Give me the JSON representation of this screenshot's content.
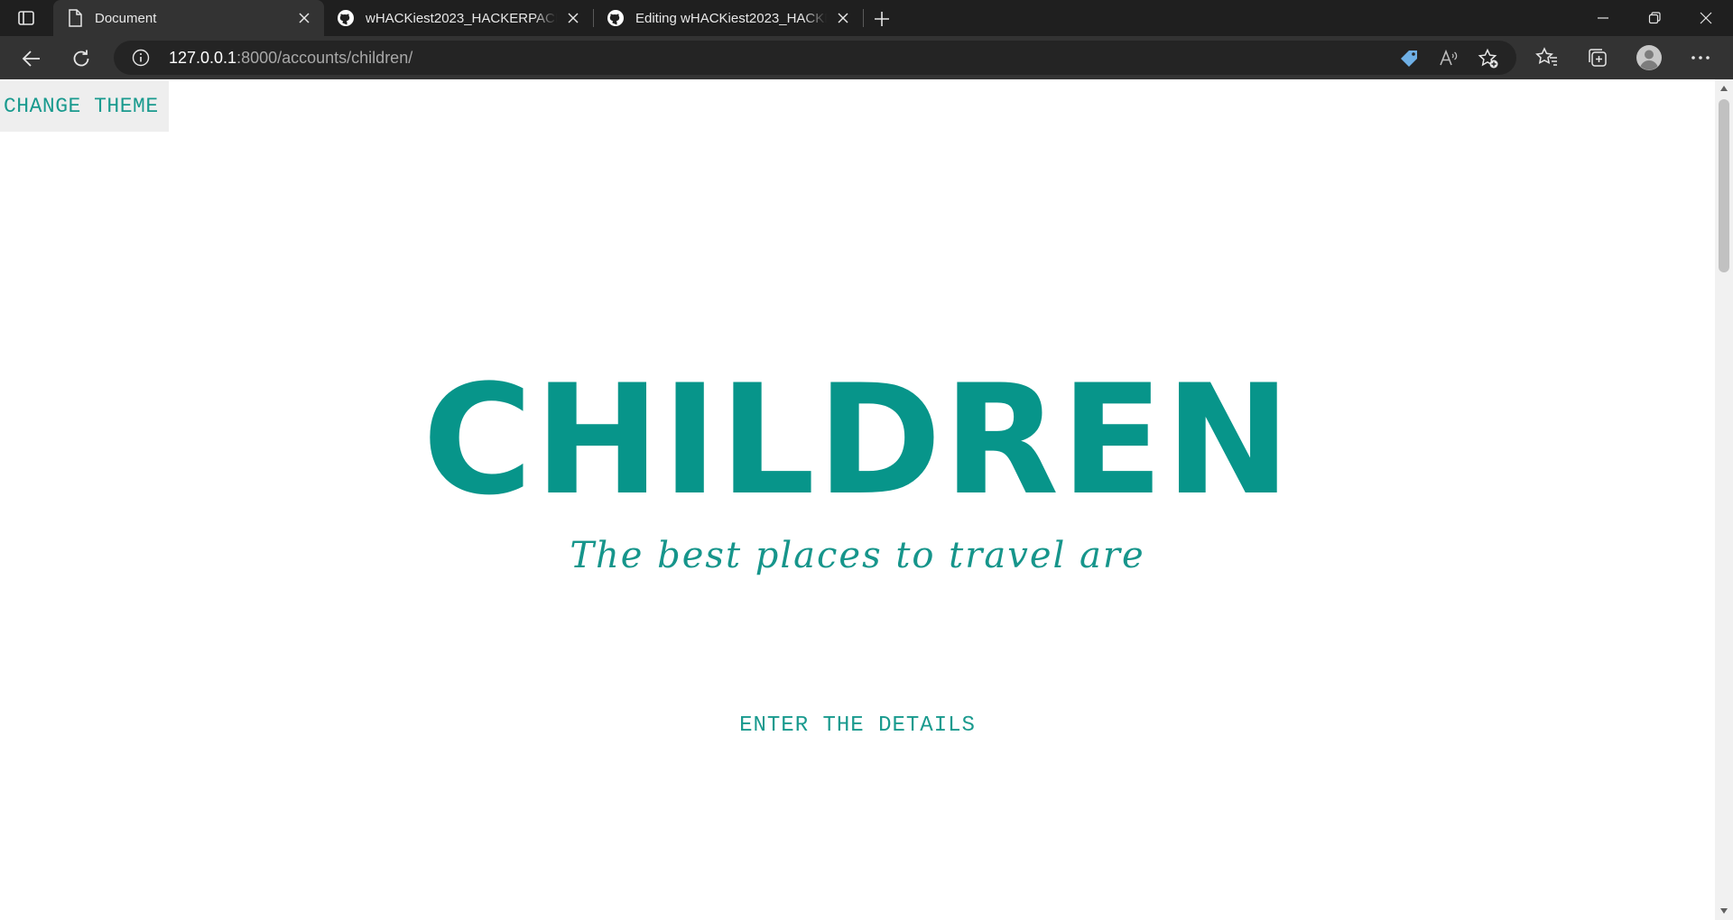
{
  "browser": {
    "tabs": [
      {
        "title": "Document",
        "favicon": "page-icon",
        "active": true
      },
      {
        "title": "wHACKiest2023_HACKERPACKERS",
        "favicon": "github-icon",
        "active": false
      },
      {
        "title": "Editing wHACKiest2023_HACKERPACKERS",
        "favicon": "github-icon",
        "active": false
      }
    ],
    "address": {
      "host": "127.0.0.1",
      "path": ":8000/accounts/children/"
    },
    "toolbar_icons": [
      "back-icon",
      "reload-icon",
      "site-info-icon",
      "shopping-tag-icon",
      "read-aloud-icon",
      "add-favorite-icon",
      "favorites-icon",
      "collections-icon",
      "profile-icon",
      "more-icon"
    ]
  },
  "page": {
    "theme_button": "CHANGE THEME",
    "title": "CHILDREN",
    "subtitle": "The best places to travel are",
    "details_link": "ENTER THE DETAILS"
  },
  "colors": {
    "accent": "#07958a",
    "chrome_dark": "#1f1f1f",
    "chrome_toolbar": "#333333"
  }
}
